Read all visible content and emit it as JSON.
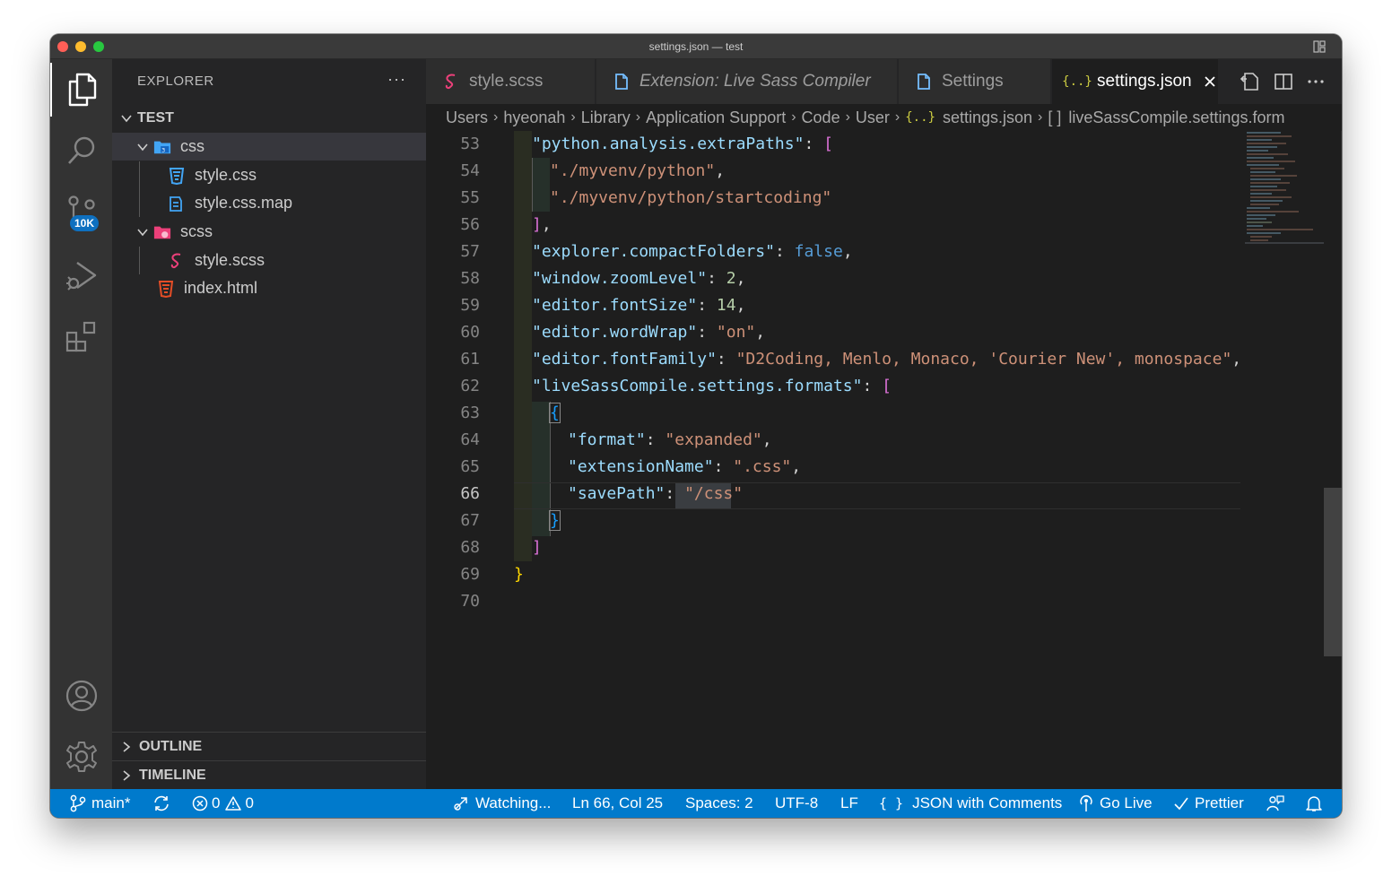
{
  "window": {
    "title": "settings.json — test"
  },
  "activity": {
    "badge": "10K"
  },
  "explorer": {
    "header": "EXPLORER",
    "more": "···",
    "root": "TEST",
    "tree": [
      {
        "label": "css",
        "type": "folder",
        "depth": 1,
        "icon": "folder-css-icon"
      },
      {
        "label": "style.css",
        "type": "file",
        "depth": 2,
        "icon": "css-file-icon"
      },
      {
        "label": "style.css.map",
        "type": "file",
        "depth": 2,
        "icon": "map-file-icon"
      },
      {
        "label": "scss",
        "type": "folder",
        "depth": 1,
        "icon": "folder-sass-icon"
      },
      {
        "label": "style.scss",
        "type": "file",
        "depth": 2,
        "icon": "sass-file-icon"
      },
      {
        "label": "index.html",
        "type": "file",
        "depth": 1,
        "icon": "html-file-icon"
      }
    ],
    "outline": "OUTLINE",
    "timeline": "TIMELINE"
  },
  "tabs": [
    {
      "label": "style.scss",
      "icon": "sass-file-icon"
    },
    {
      "label": "Extension: Live Sass Compiler",
      "icon": "document-icon"
    },
    {
      "label": "Settings",
      "icon": "document-icon"
    },
    {
      "label": "settings.json",
      "icon": "json-icon"
    }
  ],
  "breadcrumb": [
    "Users",
    "hyeonah",
    "Library",
    "Application Support",
    "Code",
    "User",
    "settings.json",
    "liveSassCompile.settings.form"
  ],
  "editor": {
    "line_numbers": [
      "53",
      "54",
      "55",
      "56",
      "57",
      "58",
      "59",
      "60",
      "61",
      "62",
      "63",
      "64",
      "65",
      "66",
      "67",
      "68",
      "69",
      "70"
    ],
    "current_line": "66"
  },
  "status": {
    "branch": "main*",
    "errors": "0",
    "warnings": "0",
    "watching": "Watching...",
    "position": "Ln 66, Col 25",
    "spaces": "Spaces: 2",
    "encoding": "UTF-8",
    "eol": "LF",
    "language": "JSON with Comments",
    "golive": "Go Live",
    "prettier": "Prettier"
  },
  "colors": {
    "accent": "#007acc",
    "key": "#9cdcfe",
    "string": "#ce9178",
    "number": "#b5cea8",
    "boolean": "#569cd6",
    "bracket_magenta": "#da70d6",
    "bracket_gold": "#ffd700",
    "bracket_blue": "#179fff"
  }
}
